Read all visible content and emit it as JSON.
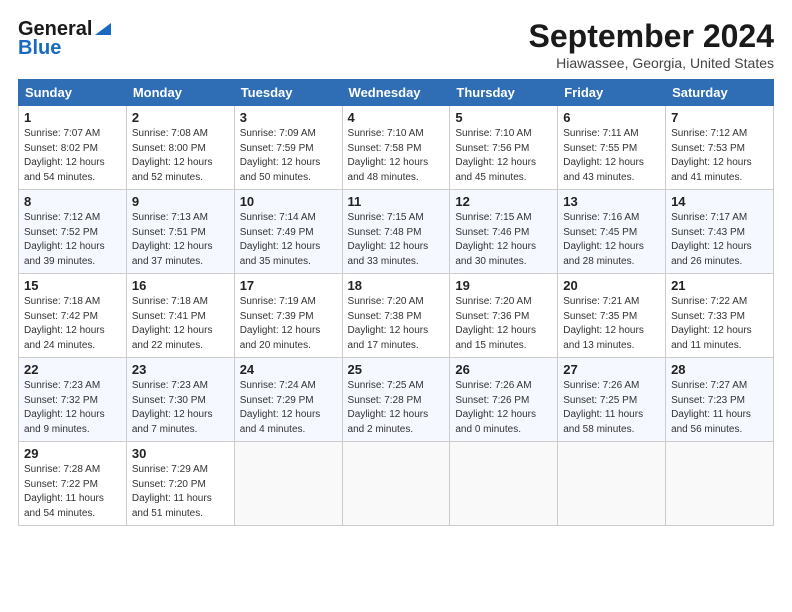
{
  "header": {
    "logo_general": "General",
    "logo_blue": "Blue",
    "month_title": "September 2024",
    "location": "Hiawassee, Georgia, United States"
  },
  "weekdays": [
    "Sunday",
    "Monday",
    "Tuesday",
    "Wednesday",
    "Thursday",
    "Friday",
    "Saturday"
  ],
  "weeks": [
    [
      {
        "day": "1",
        "detail": "Sunrise: 7:07 AM\nSunset: 8:02 PM\nDaylight: 12 hours\nand 54 minutes."
      },
      {
        "day": "2",
        "detail": "Sunrise: 7:08 AM\nSunset: 8:00 PM\nDaylight: 12 hours\nand 52 minutes."
      },
      {
        "day": "3",
        "detail": "Sunrise: 7:09 AM\nSunset: 7:59 PM\nDaylight: 12 hours\nand 50 minutes."
      },
      {
        "day": "4",
        "detail": "Sunrise: 7:10 AM\nSunset: 7:58 PM\nDaylight: 12 hours\nand 48 minutes."
      },
      {
        "day": "5",
        "detail": "Sunrise: 7:10 AM\nSunset: 7:56 PM\nDaylight: 12 hours\nand 45 minutes."
      },
      {
        "day": "6",
        "detail": "Sunrise: 7:11 AM\nSunset: 7:55 PM\nDaylight: 12 hours\nand 43 minutes."
      },
      {
        "day": "7",
        "detail": "Sunrise: 7:12 AM\nSunset: 7:53 PM\nDaylight: 12 hours\nand 41 minutes."
      }
    ],
    [
      {
        "day": "8",
        "detail": "Sunrise: 7:12 AM\nSunset: 7:52 PM\nDaylight: 12 hours\nand 39 minutes."
      },
      {
        "day": "9",
        "detail": "Sunrise: 7:13 AM\nSunset: 7:51 PM\nDaylight: 12 hours\nand 37 minutes."
      },
      {
        "day": "10",
        "detail": "Sunrise: 7:14 AM\nSunset: 7:49 PM\nDaylight: 12 hours\nand 35 minutes."
      },
      {
        "day": "11",
        "detail": "Sunrise: 7:15 AM\nSunset: 7:48 PM\nDaylight: 12 hours\nand 33 minutes."
      },
      {
        "day": "12",
        "detail": "Sunrise: 7:15 AM\nSunset: 7:46 PM\nDaylight: 12 hours\nand 30 minutes."
      },
      {
        "day": "13",
        "detail": "Sunrise: 7:16 AM\nSunset: 7:45 PM\nDaylight: 12 hours\nand 28 minutes."
      },
      {
        "day": "14",
        "detail": "Sunrise: 7:17 AM\nSunset: 7:43 PM\nDaylight: 12 hours\nand 26 minutes."
      }
    ],
    [
      {
        "day": "15",
        "detail": "Sunrise: 7:18 AM\nSunset: 7:42 PM\nDaylight: 12 hours\nand 24 minutes."
      },
      {
        "day": "16",
        "detail": "Sunrise: 7:18 AM\nSunset: 7:41 PM\nDaylight: 12 hours\nand 22 minutes."
      },
      {
        "day": "17",
        "detail": "Sunrise: 7:19 AM\nSunset: 7:39 PM\nDaylight: 12 hours\nand 20 minutes."
      },
      {
        "day": "18",
        "detail": "Sunrise: 7:20 AM\nSunset: 7:38 PM\nDaylight: 12 hours\nand 17 minutes."
      },
      {
        "day": "19",
        "detail": "Sunrise: 7:20 AM\nSunset: 7:36 PM\nDaylight: 12 hours\nand 15 minutes."
      },
      {
        "day": "20",
        "detail": "Sunrise: 7:21 AM\nSunset: 7:35 PM\nDaylight: 12 hours\nand 13 minutes."
      },
      {
        "day": "21",
        "detail": "Sunrise: 7:22 AM\nSunset: 7:33 PM\nDaylight: 12 hours\nand 11 minutes."
      }
    ],
    [
      {
        "day": "22",
        "detail": "Sunrise: 7:23 AM\nSunset: 7:32 PM\nDaylight: 12 hours\nand 9 minutes."
      },
      {
        "day": "23",
        "detail": "Sunrise: 7:23 AM\nSunset: 7:30 PM\nDaylight: 12 hours\nand 7 minutes."
      },
      {
        "day": "24",
        "detail": "Sunrise: 7:24 AM\nSunset: 7:29 PM\nDaylight: 12 hours\nand 4 minutes."
      },
      {
        "day": "25",
        "detail": "Sunrise: 7:25 AM\nSunset: 7:28 PM\nDaylight: 12 hours\nand 2 minutes."
      },
      {
        "day": "26",
        "detail": "Sunrise: 7:26 AM\nSunset: 7:26 PM\nDaylight: 12 hours\nand 0 minutes."
      },
      {
        "day": "27",
        "detail": "Sunrise: 7:26 AM\nSunset: 7:25 PM\nDaylight: 11 hours\nand 58 minutes."
      },
      {
        "day": "28",
        "detail": "Sunrise: 7:27 AM\nSunset: 7:23 PM\nDaylight: 11 hours\nand 56 minutes."
      }
    ],
    [
      {
        "day": "29",
        "detail": "Sunrise: 7:28 AM\nSunset: 7:22 PM\nDaylight: 11 hours\nand 54 minutes."
      },
      {
        "day": "30",
        "detail": "Sunrise: 7:29 AM\nSunset: 7:20 PM\nDaylight: 11 hours\nand 51 minutes."
      },
      {
        "day": "",
        "detail": ""
      },
      {
        "day": "",
        "detail": ""
      },
      {
        "day": "",
        "detail": ""
      },
      {
        "day": "",
        "detail": ""
      },
      {
        "day": "",
        "detail": ""
      }
    ]
  ]
}
